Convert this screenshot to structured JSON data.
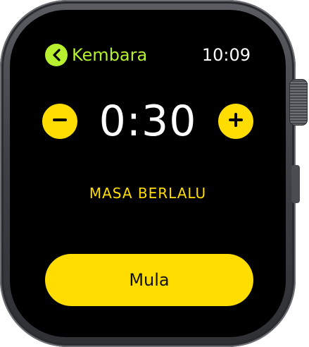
{
  "header": {
    "back_label": "Kembara",
    "back_icon": "chevron-left-icon",
    "time": "10:09"
  },
  "timer": {
    "value": "0:30",
    "decrement_icon": "minus-icon",
    "increment_icon": "plus-icon"
  },
  "metric": {
    "label": "MASA BERLALU"
  },
  "actions": {
    "start_label": "Mula"
  },
  "colors": {
    "back_accent": "#b6f02e",
    "yellow_accent": "#ffdd00",
    "screen_bg": "#000000",
    "text_primary": "#ffffff"
  }
}
